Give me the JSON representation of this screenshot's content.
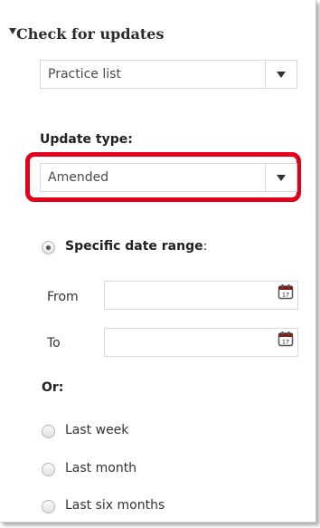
{
  "panel": {
    "section_title": "Check for updates",
    "list_select": {
      "value": "Practice list"
    },
    "update_type": {
      "label": "Update type:",
      "value": "Amended",
      "highlight_color": "#e3001b"
    },
    "date_range": {
      "label": "Specific date range",
      "colon": ":",
      "from_label": "From",
      "to_label": "To",
      "from_value": "",
      "to_value": "",
      "calendar_day": "17"
    },
    "or_label": "Or:",
    "options": [
      "Last week",
      "Last month",
      "Last six months"
    ]
  }
}
